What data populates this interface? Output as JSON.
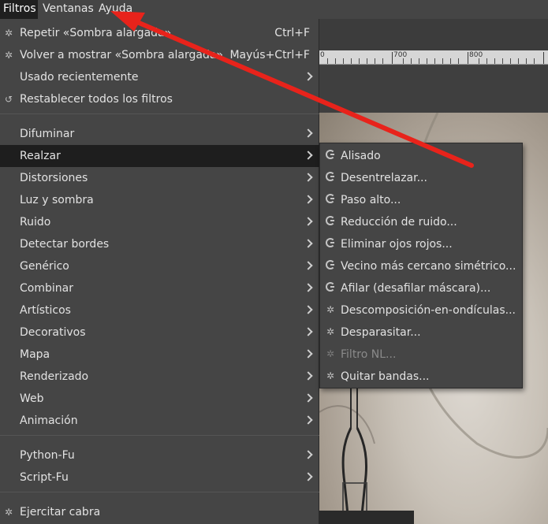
{
  "menubar": {
    "items": [
      {
        "label": "Filtros",
        "active": true
      },
      {
        "label": "Ventanas",
        "active": false
      },
      {
        "label": "Ayuda",
        "active": false
      }
    ]
  },
  "ruler": {
    "labels": [
      "0",
      "700",
      "800"
    ]
  },
  "filters_menu": {
    "repeat": {
      "label": "Repetir «Sombra alargada»",
      "accel": "Ctrl+F",
      "icon": "gear-icon"
    },
    "reshow": {
      "label": "Volver a mostrar «Sombra alargada»",
      "accel": "Mayús+Ctrl+F",
      "icon": "gear-icon"
    },
    "recent": {
      "label": "Usado recientemente"
    },
    "reset": {
      "label": "Restablecer todos los filtros",
      "icon": "reset-icon"
    },
    "categories": [
      "Difuminar",
      "Realzar",
      "Distorsiones",
      "Luz y sombra",
      "Ruido",
      "Detectar bordes",
      "Genérico",
      "Combinar",
      "Artísticos",
      "Decorativos",
      "Mapa",
      "Renderizado",
      "Web",
      "Animación"
    ],
    "scripts": [
      "Python-Fu",
      "Script-Fu"
    ],
    "goat": {
      "label": "Ejercitar cabra",
      "icon": "gear-icon"
    }
  },
  "enhance_submenu": {
    "items": [
      {
        "label": "Alisado",
        "icon": "gegl-icon",
        "disabled": false
      },
      {
        "label": "Desentrelazar...",
        "icon": "gegl-icon",
        "disabled": false
      },
      {
        "label": "Paso alto...",
        "icon": "gegl-icon",
        "disabled": false
      },
      {
        "label": "Reducción de ruido...",
        "icon": "gegl-icon",
        "disabled": false
      },
      {
        "label": "Eliminar ojos rojos...",
        "icon": "gegl-icon",
        "disabled": false
      },
      {
        "label": "Vecino más cercano simétrico...",
        "icon": "gegl-icon",
        "disabled": false
      },
      {
        "label": "Afilar (desafilar máscara)...",
        "icon": "gegl-icon",
        "disabled": false
      },
      {
        "label": "Descomposición-en-ondículas...",
        "icon": "gear-icon",
        "disabled": false
      },
      {
        "label": "Desparasitar...",
        "icon": "gear-icon",
        "disabled": false
      },
      {
        "label": "Filtro NL...",
        "icon": "gear-icon",
        "disabled": true
      },
      {
        "label": "Quitar bandas...",
        "icon": "gear-icon",
        "disabled": false
      }
    ]
  },
  "colors": {
    "menu_bg": "#454545",
    "highlight_bg": "#1e1e1e",
    "annotation_arrow": "#e8231b"
  }
}
